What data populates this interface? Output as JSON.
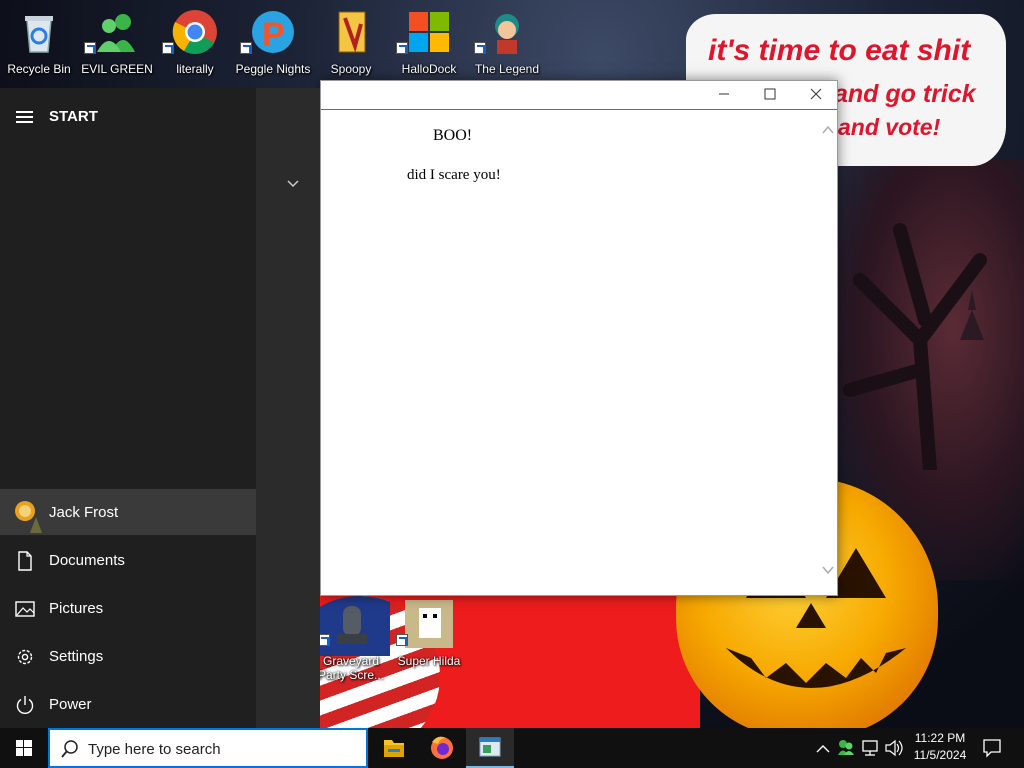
{
  "desktop": {
    "icons": [
      {
        "label": "Recycle Bin",
        "icon": "recycle-bin-icon"
      },
      {
        "label": "EVIL GREEN MEN CO",
        "icon": "green-men-icon"
      },
      {
        "label": "literally",
        "icon": "chrome-icon"
      },
      {
        "label": "Peggle Nights",
        "icon": "peggle-icon"
      },
      {
        "label": "Spoopy",
        "icon": "spoopy-icon"
      },
      {
        "label": "HalloDock",
        "icon": "windows-logo-icon"
      },
      {
        "label": "The Legend",
        "icon": "legend-game-icon"
      },
      {
        "label": "Graveyard Party Scre...",
        "icon": "graveyard-icon"
      },
      {
        "label": "Super Hilda",
        "icon": "super-hilda-icon"
      }
    ],
    "bubble_lines": [
      "it's time to eat shit",
      "and go trick",
      "and vote!"
    ]
  },
  "window": {
    "heading": "BOO!",
    "message": "did I scare you!"
  },
  "start_menu": {
    "title": "START",
    "user": "Jack Frost",
    "items": [
      {
        "label": "Documents",
        "icon": "document-icon"
      },
      {
        "label": "Pictures",
        "icon": "pictures-icon"
      },
      {
        "label": "Settings",
        "icon": "gear-icon"
      },
      {
        "label": "Power",
        "icon": "power-icon"
      }
    ]
  },
  "taskbar": {
    "search_placeholder": "Type here to search",
    "apps": [
      "file-explorer-icon",
      "firefox-icon",
      "notepad-app-icon"
    ],
    "time": "11:22 PM",
    "date": "11/5/2024"
  },
  "colors": {
    "accent": "#0078d7",
    "bubble_text": "#e0142b",
    "start_bg": "#2b2b2b"
  }
}
